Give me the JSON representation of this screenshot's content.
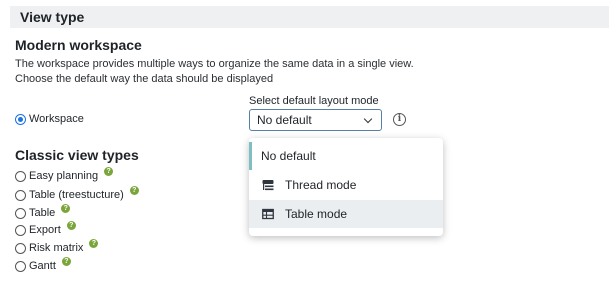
{
  "section": {
    "title": "View type"
  },
  "modern": {
    "heading": "Modern workspace",
    "description": "The workspace provides multiple ways to organize the same data in a single view. Choose the default way the data should be displayed",
    "option_label": "Workspace",
    "select_label": "Select default layout mode",
    "select_value": "No default",
    "dropdown": [
      {
        "label": "No default",
        "icon": null
      },
      {
        "label": "Thread mode",
        "icon": "thread-icon"
      },
      {
        "label": "Table mode",
        "icon": "table-icon"
      }
    ]
  },
  "classic": {
    "heading": "Classic view types",
    "options": [
      {
        "label": "Easy planning"
      },
      {
        "label": "Table (treestucture)"
      },
      {
        "label": "Table"
      },
      {
        "label": "Export"
      },
      {
        "label": "Risk matrix"
      },
      {
        "label": "Gantt"
      }
    ]
  },
  "help_glyph": "?",
  "info_glyph": "i",
  "colors": {
    "accent": "#1a73e8",
    "help": "#7aa53a",
    "selected_marker": "#7fbfc4"
  }
}
